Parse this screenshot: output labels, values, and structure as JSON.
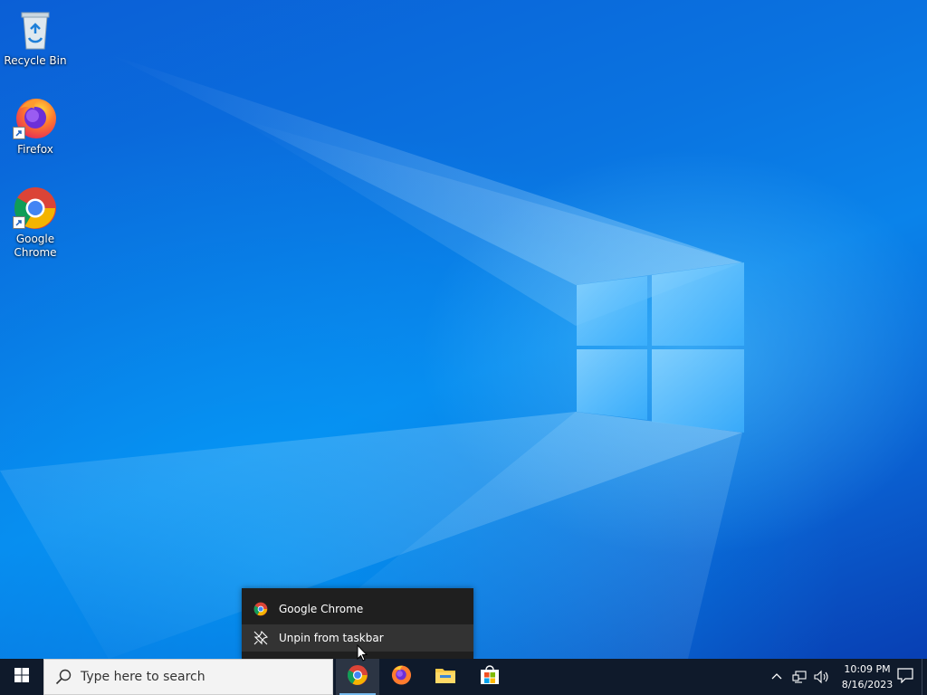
{
  "desktop": {
    "icons": [
      {
        "label": "Recycle Bin",
        "icon": "recycle-bin-icon"
      },
      {
        "label": "Firefox",
        "icon": "firefox-icon"
      },
      {
        "label": "Google Chrome",
        "icon": "chrome-icon"
      }
    ]
  },
  "jump_list": {
    "items": [
      {
        "label": "Google Chrome",
        "icon": "chrome-icon"
      },
      {
        "label": "Unpin from taskbar",
        "icon": "unpin-icon"
      }
    ]
  },
  "taskbar": {
    "start_icon": "windows-logo-icon",
    "search": {
      "placeholder": "Type here to search",
      "icon": "search-icon"
    },
    "apps": [
      {
        "name": "Google Chrome",
        "icon": "chrome-icon",
        "active": true
      },
      {
        "name": "Firefox",
        "icon": "firefox-icon",
        "active": false
      },
      {
        "name": "File Explorer",
        "icon": "folder-icon",
        "active": false
      },
      {
        "name": "Microsoft Store",
        "icon": "store-icon",
        "active": false
      }
    ],
    "tray": {
      "icons": [
        "chevron-up-icon",
        "network-icon",
        "volume-icon"
      ],
      "time": "10:09 PM",
      "date": "8/16/2023",
      "notification_icon": "notification-icon"
    }
  },
  "colors": {
    "taskbar_bg": "#0f1a2b",
    "menu_bg": "#1f1f1f",
    "menu_hover": "#333333",
    "desktop_blue": "#0a73e0",
    "active_indicator": "#76b9ed"
  }
}
